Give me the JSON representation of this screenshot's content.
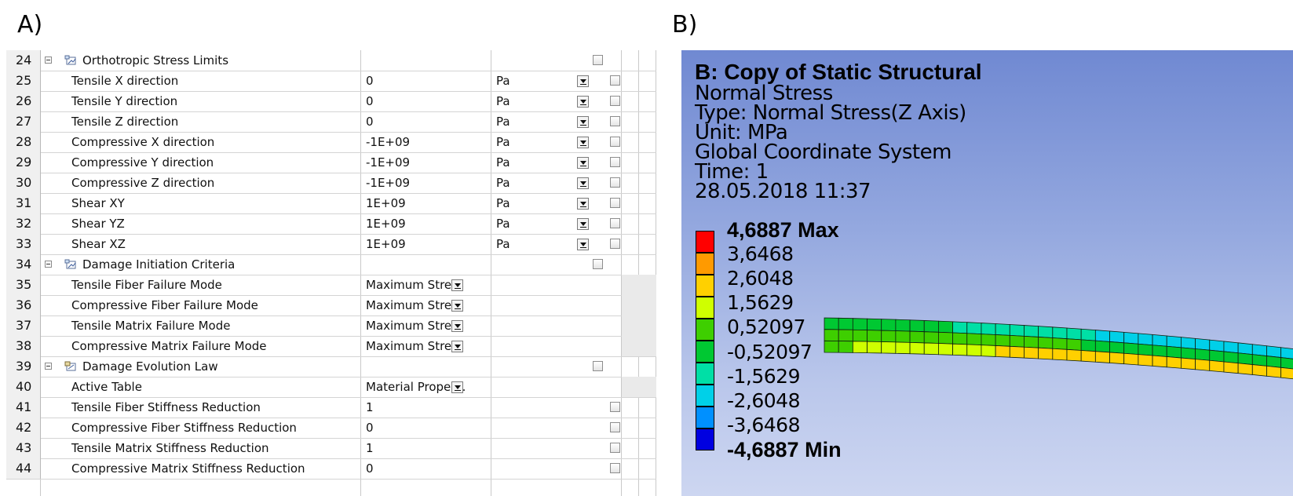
{
  "panel_labels": {
    "a": "A)",
    "b": "B)"
  },
  "grid": {
    "rows": [
      {
        "num": "24",
        "type": "group",
        "name": "Orthotropic Stress Limits",
        "icon": "table-group-icon",
        "checkbox_col": "unit"
      },
      {
        "num": "25",
        "type": "unit",
        "name": "Tensile X direction",
        "value": "0",
        "unit": "Pa"
      },
      {
        "num": "26",
        "type": "unit",
        "name": "Tensile Y direction",
        "value": "0",
        "unit": "Pa"
      },
      {
        "num": "27",
        "type": "unit",
        "name": "Tensile Z direction",
        "value": "0",
        "unit": "Pa"
      },
      {
        "num": "28",
        "type": "unit",
        "name": "Compressive X direction",
        "value": "-1E+09",
        "unit": "Pa"
      },
      {
        "num": "29",
        "type": "unit",
        "name": "Compressive Y direction",
        "value": "-1E+09",
        "unit": "Pa"
      },
      {
        "num": "30",
        "type": "unit",
        "name": "Compressive Z direction",
        "value": "-1E+09",
        "unit": "Pa"
      },
      {
        "num": "31",
        "type": "unit",
        "name": "Shear XY",
        "value": "1E+09",
        "unit": "Pa"
      },
      {
        "num": "32",
        "type": "unit",
        "name": "Shear YZ",
        "value": "1E+09",
        "unit": "Pa"
      },
      {
        "num": "33",
        "type": "unit",
        "name": "Shear XZ",
        "value": "1E+09",
        "unit": "Pa"
      },
      {
        "num": "34",
        "type": "group",
        "name": "Damage Initiation Criteria",
        "icon": "table-group-icon"
      },
      {
        "num": "35",
        "type": "select",
        "name": "Tensile Fiber Failure Mode",
        "value": "Maximum Stress"
      },
      {
        "num": "36",
        "type": "select",
        "name": "Compressive Fiber Failure Mode",
        "value": "Maximum Stress"
      },
      {
        "num": "37",
        "type": "select",
        "name": "Tensile Matrix Failure Mode",
        "value": "Maximum Stress"
      },
      {
        "num": "38",
        "type": "select",
        "name": "Compressive Matrix Failure Mode",
        "value": "Maximum Stress"
      },
      {
        "num": "39",
        "type": "group",
        "name": "Damage Evolution Law",
        "icon": "evolution-group-icon"
      },
      {
        "num": "40",
        "type": "select",
        "name": "Active Table",
        "value": "Material Proper..."
      },
      {
        "num": "41",
        "type": "plain",
        "name": "Tensile Fiber Stiffness Reduction",
        "value": "1"
      },
      {
        "num": "42",
        "type": "plain",
        "name": "Compressive Fiber Stiffness Reduction",
        "value": "0"
      },
      {
        "num": "43",
        "type": "plain",
        "name": "Tensile Matrix Stiffness Reduction",
        "value": "1"
      },
      {
        "num": "44",
        "type": "plain",
        "name": "Compressive Matrix Stiffness Reduction",
        "value": "0"
      }
    ]
  },
  "result": {
    "title": "B: Copy of Static Structural",
    "lines": [
      "Normal Stress",
      "Type: Normal Stress(Z Axis)",
      "Unit: MPa",
      "Global Coordinate System",
      "Time: 1",
      "28.05.2018 11:37"
    ],
    "legend": {
      "labels": [
        "4,6887 Max",
        "3,6468",
        "2,6048",
        "1,5629",
        "0,52097",
        "-0,52097",
        "-1,5629",
        "-2,6048",
        "-3,6468",
        "-4,6887 Min"
      ],
      "colors": [
        "#ff0000",
        "#ff9a00",
        "#ffd000",
        "#cfff00",
        "#3ecf00",
        "#00c832",
        "#00dfa6",
        "#00d0e8",
        "#0090ff",
        "#0000e0"
      ]
    }
  }
}
